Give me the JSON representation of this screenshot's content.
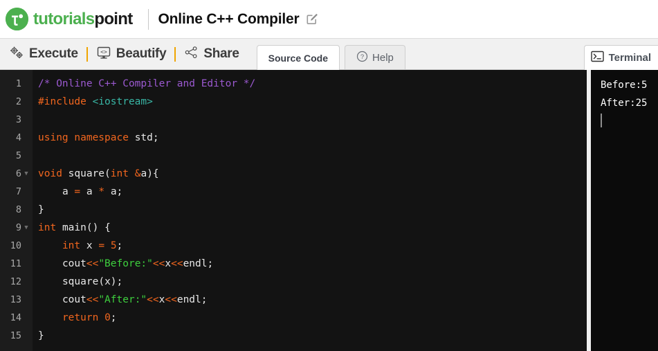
{
  "header": {
    "brand_primary": "tutorials",
    "brand_secondary": "point",
    "brand_icon": "tutorialspoint-logo-icon",
    "page_title": "Online C++ Compiler",
    "edit_icon": "edit-pencil-icon"
  },
  "toolbar": {
    "actions": [
      {
        "label": "Execute",
        "icon": "gears-icon"
      },
      {
        "label": "Beautify",
        "icon": "monitor-code-icon"
      },
      {
        "label": "Share",
        "icon": "share-nodes-icon"
      }
    ],
    "tabs": [
      {
        "label": "Source Code",
        "active": true,
        "icon": ""
      },
      {
        "label": "Help",
        "active": false,
        "icon": "question-circle-icon"
      }
    ],
    "terminal_tab": {
      "label": "Terminal",
      "icon": "terminal-prompt-icon"
    }
  },
  "editor": {
    "language": "cpp",
    "lines": [
      {
        "n": 1,
        "fold": false,
        "text": "/* Online C++ Compiler and Editor */"
      },
      {
        "n": 2,
        "fold": false,
        "text": "#include <iostream>"
      },
      {
        "n": 3,
        "fold": false,
        "text": ""
      },
      {
        "n": 4,
        "fold": false,
        "text": "using namespace std;"
      },
      {
        "n": 5,
        "fold": false,
        "text": ""
      },
      {
        "n": 6,
        "fold": true,
        "text": "void square(int &a){"
      },
      {
        "n": 7,
        "fold": false,
        "text": "    a = a * a;"
      },
      {
        "n": 8,
        "fold": false,
        "text": "}"
      },
      {
        "n": 9,
        "fold": true,
        "text": "int main() {"
      },
      {
        "n": 10,
        "fold": false,
        "text": "    int x = 5;"
      },
      {
        "n": 11,
        "fold": false,
        "text": "    cout<<\"Before:\"<<x<<endl;"
      },
      {
        "n": 12,
        "fold": false,
        "text": "    square(x);"
      },
      {
        "n": 13,
        "fold": false,
        "text": "    cout<<\"After:\"<<x<<endl;"
      },
      {
        "n": 14,
        "fold": false,
        "text": "    return 0;"
      },
      {
        "n": 15,
        "fold": false,
        "text": "}"
      }
    ]
  },
  "terminal": {
    "output_lines": [
      "Before:5",
      "After:25"
    ],
    "cursor_visible": true
  },
  "colors": {
    "brand_green": "#4cb04f",
    "toolbar_bg": "#f1f1f1",
    "editor_bg": "#131313",
    "gutter_bg": "#1c1c1c",
    "terminal_bg": "#0b0b0b",
    "accent_separator": "#f0a500",
    "syntax_comment": "#9b59d0",
    "syntax_keyword": "#f2661e",
    "syntax_string": "#3ecf3e",
    "syntax_include": "#39b7a6"
  }
}
